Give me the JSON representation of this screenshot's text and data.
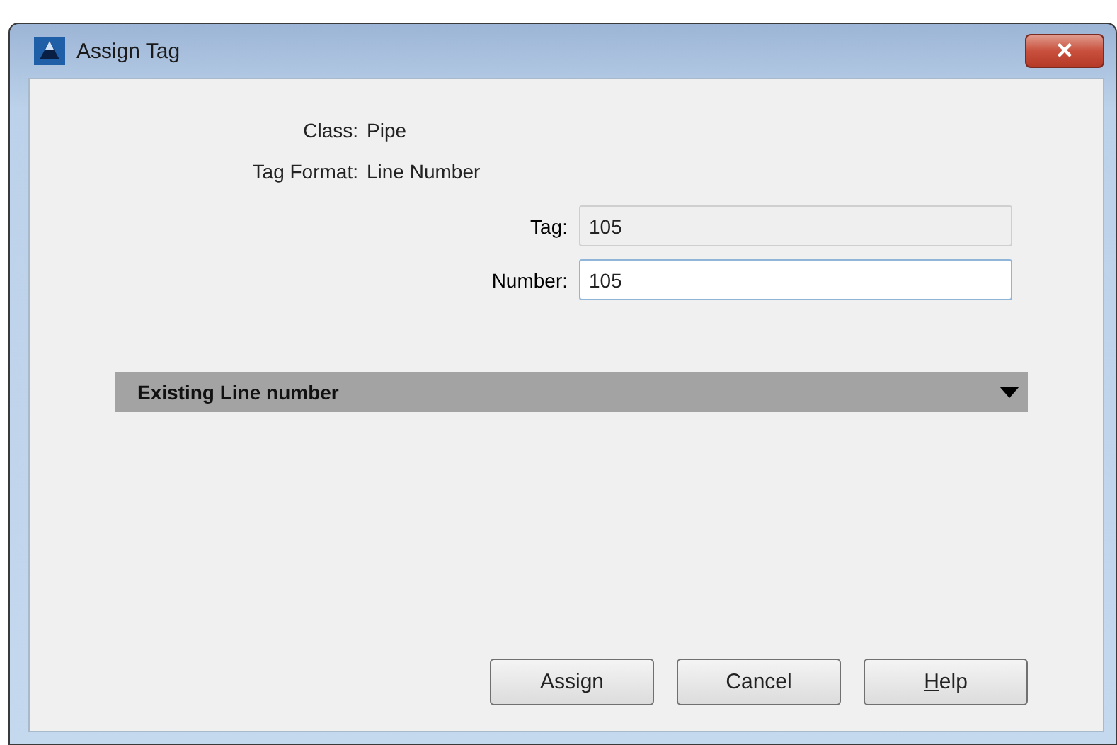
{
  "window": {
    "title": "Assign Tag",
    "close": "×"
  },
  "info": [
    {
      "label": "Class:",
      "value": "Pipe"
    },
    {
      "label": "Tag Format:",
      "value": "Line Number"
    }
  ],
  "fields": [
    {
      "label": "Tag:",
      "value": "105",
      "disabled": true
    },
    {
      "label": "Number:",
      "value": "105",
      "disabled": false
    }
  ],
  "section": {
    "title": "Existing Line number",
    "expanded": false
  },
  "buttons": [
    {
      "label": "Assign",
      "first_letter_underlined": false
    },
    {
      "label": "Cancel",
      "first_letter_underlined": false
    },
    {
      "label": "Help",
      "first_letter_underlined": true
    }
  ]
}
